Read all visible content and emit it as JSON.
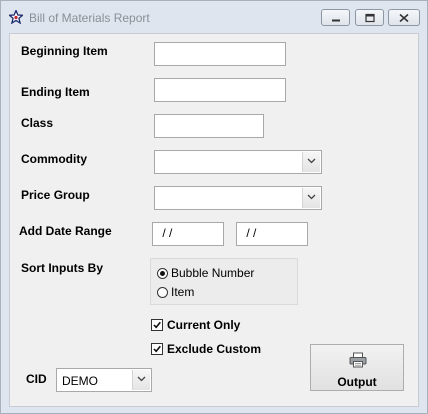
{
  "window": {
    "title": "Bill of Materials Report",
    "icon": "star-icon"
  },
  "form": {
    "beginning_item": {
      "label": "Beginning Item",
      "value": ""
    },
    "ending_item": {
      "label": "Ending Item",
      "value": ""
    },
    "class": {
      "label": "Class",
      "value": ""
    },
    "commodity": {
      "label": "Commodity",
      "value": ""
    },
    "price_group": {
      "label": "Price Group",
      "value": ""
    },
    "date_range": {
      "label": "Add Date Range",
      "start": " / /",
      "end": " / /"
    },
    "sort_inputs": {
      "label": "Sort Inputs By",
      "options": [
        {
          "label": "Bubble Number",
          "selected": true
        },
        {
          "label": "Item",
          "selected": false
        }
      ]
    },
    "current_only": {
      "label": "Current Only",
      "checked": true
    },
    "exclude_custom": {
      "label": "Exclude Custom",
      "checked": true
    },
    "cid": {
      "label": "CID",
      "value": "DEMO"
    },
    "output_button": {
      "label": "Output",
      "icon": "printer-icon"
    }
  }
}
